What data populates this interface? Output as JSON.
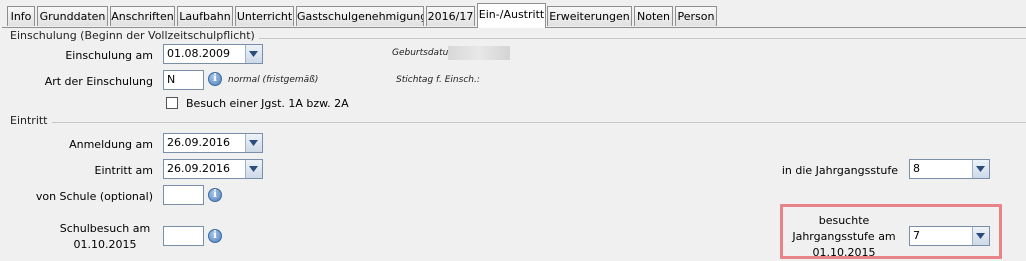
{
  "tabs": [
    {
      "label": "Info"
    },
    {
      "label": "Grunddaten"
    },
    {
      "label": "Anschriften"
    },
    {
      "label": "Laufbahn"
    },
    {
      "label": "Unterricht"
    },
    {
      "label": "Gastschulgenehmigung"
    },
    {
      "label": "2016/17"
    },
    {
      "label": "Ein-/Austritt",
      "active": true
    },
    {
      "label": "Erweiterungen"
    },
    {
      "label": "Noten"
    },
    {
      "label": "Person"
    }
  ],
  "einschulung": {
    "section_title": "Einschulung (Beginn der Vollzeitschulpflicht)",
    "einschulung_am_label": "Einschulung am",
    "einschulung_am_value": "01.08.2009",
    "geburtsdatum_label": "Geburtsdatum",
    "art_label": "Art der Einschulung",
    "art_value": "N",
    "art_desc": "normal (fristgemäß)",
    "stichtag_label": "Stichtag f. Einsch.:",
    "besuch_label": "Besuch einer Jgst. 1A bzw. 2A",
    "besuch_checked": false
  },
  "eintritt": {
    "section_title": "Eintritt",
    "anmeldung_label": "Anmeldung am",
    "anmeldung_value": "26.09.2016",
    "eintritt_label": "Eintritt am",
    "eintritt_value": "26.09.2016",
    "jahrgangsstufe_label": "in die Jahrgangsstufe",
    "jahrgangsstufe_value": "8",
    "von_schule_label": "von Schule (optional)",
    "von_schule_value": "",
    "schulbesuch_label_1": "Schulbesuch am",
    "schulbesuch_label_2": "01.10.2015",
    "schulbesuch_value": "",
    "besuchte_label_1": "besuchte",
    "besuchte_label_2": "Jahrgangsstufe am",
    "besuchte_label_3": "01.10.2015",
    "besuchte_value": "7"
  },
  "colors": {
    "highlight": "#e8838a",
    "accent": "#4f7fb8"
  }
}
